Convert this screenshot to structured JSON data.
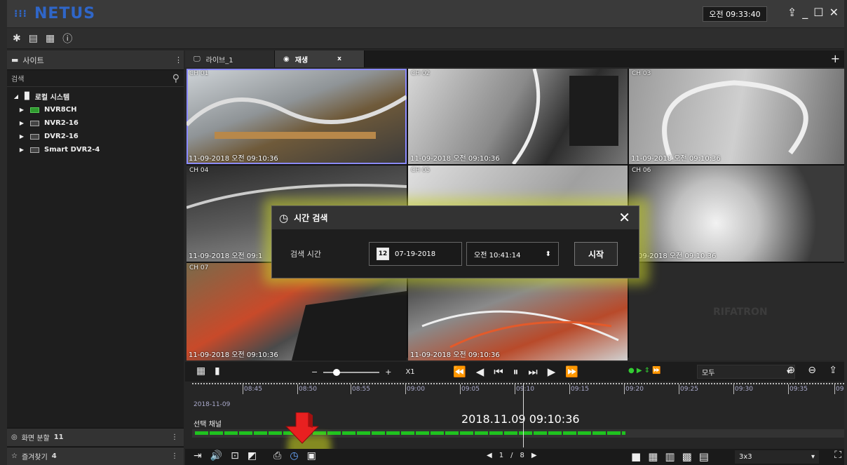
{
  "app": {
    "title": "NETUS",
    "clock": "오전 09:33:40"
  },
  "sidebar": {
    "header": "사이트",
    "search_label": "검색",
    "root": "로컬 시스템",
    "devices": [
      "NVR8CH",
      "NVR2-16",
      "DVR2-16",
      "Smart DVR2-4"
    ],
    "split_label": "화면 분할",
    "split_count": "11",
    "favorites_label": "즐겨찾기",
    "favorites_count": "4"
  },
  "tabs": [
    {
      "label": "라이브_1"
    },
    {
      "label": "재생",
      "close": "x"
    }
  ],
  "cameras": [
    {
      "label": "CH 01",
      "ts": "11-09-2018  오전 09:10:36"
    },
    {
      "label": "CH 02",
      "ts": "11-09-2018  오전 09:10:36"
    },
    {
      "label": "CH 03",
      "ts": "11-09-2018  오전 09:10:36"
    },
    {
      "label": "CH 04",
      "ts": "11-09-2018  오전 09:1"
    },
    {
      "label": "CH 05",
      "ts": ""
    },
    {
      "label": "CH 06",
      "ts": "1-09-2018  오전 09:10:36"
    },
    {
      "label": "CH 07",
      "ts": "11-09-2018  오전 09:10:36"
    },
    {
      "label": "",
      "ts": "11-09-2018  오전 09:10:36"
    }
  ],
  "watermark": "RIFATRON",
  "dialog": {
    "title": "시간 검색",
    "label": "검색 시간",
    "date": "07-19-2018",
    "time": "오전 10:41:14",
    "start": "시작",
    "calendar_day": "12"
  },
  "controls": {
    "speed": "X1",
    "filter": "모두"
  },
  "timeline": {
    "date": "2018-11-09",
    "current": "2018.11.09  09:10:36",
    "selected_channel": "선택 채널",
    "ticks": [
      "08:45",
      "08:50",
      "08:55",
      "09:00",
      "09:05",
      "09:10",
      "09:15",
      "09:20",
      "09:25",
      "09:30",
      "09:35",
      "09"
    ]
  },
  "pager": {
    "current": "1",
    "sep": "/",
    "total": "8"
  },
  "layout": {
    "selected": "3x3"
  },
  "colors": {
    "accent": "#2f66c8",
    "record": "#1fc31f",
    "highlight": "#d4dc1e"
  }
}
